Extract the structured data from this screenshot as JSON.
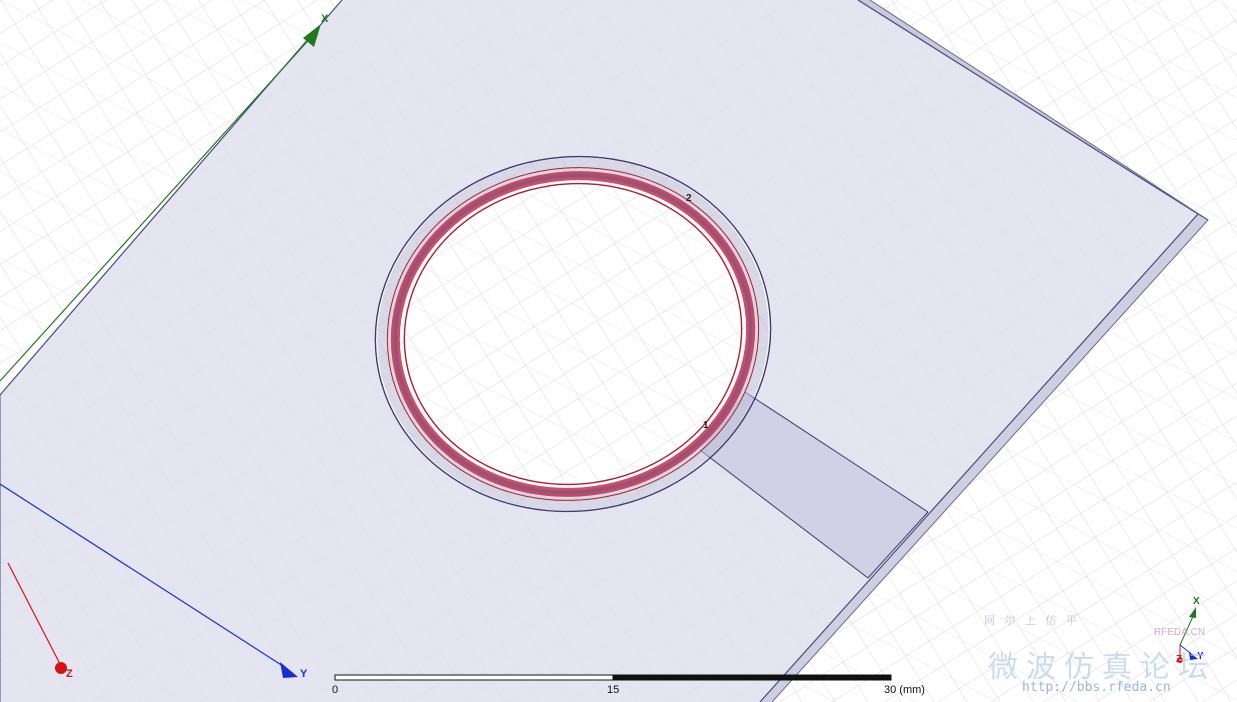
{
  "viewport": {
    "main_axes": {
      "x_label": "X",
      "y_label": "Y",
      "z_label": "Z"
    },
    "mini_axes": {
      "x_label": "X",
      "y_label": "Y",
      "z_label": "Z"
    },
    "ports": [
      "1",
      "2"
    ]
  },
  "ruler": {
    "tick_start": "0",
    "tick_mid": "15",
    "tick_end": "30 (mm)"
  },
  "watermark": {
    "slogan": "网 尔 上 仿 平",
    "site": "RFEDA.CN",
    "title": "微波仿真论坛",
    "url": "http://bbs.rfeda.cn"
  },
  "colors": {
    "background": "#ffffff",
    "grid": "#d9d9d9",
    "substrate_fill": "#e3e3ef",
    "substrate_edge": "#4a4a7a",
    "ring_conductor": "#c43048",
    "axis_x": "#1e7a1e",
    "axis_y": "#1a2ed0",
    "axis_z": "#d41414"
  }
}
